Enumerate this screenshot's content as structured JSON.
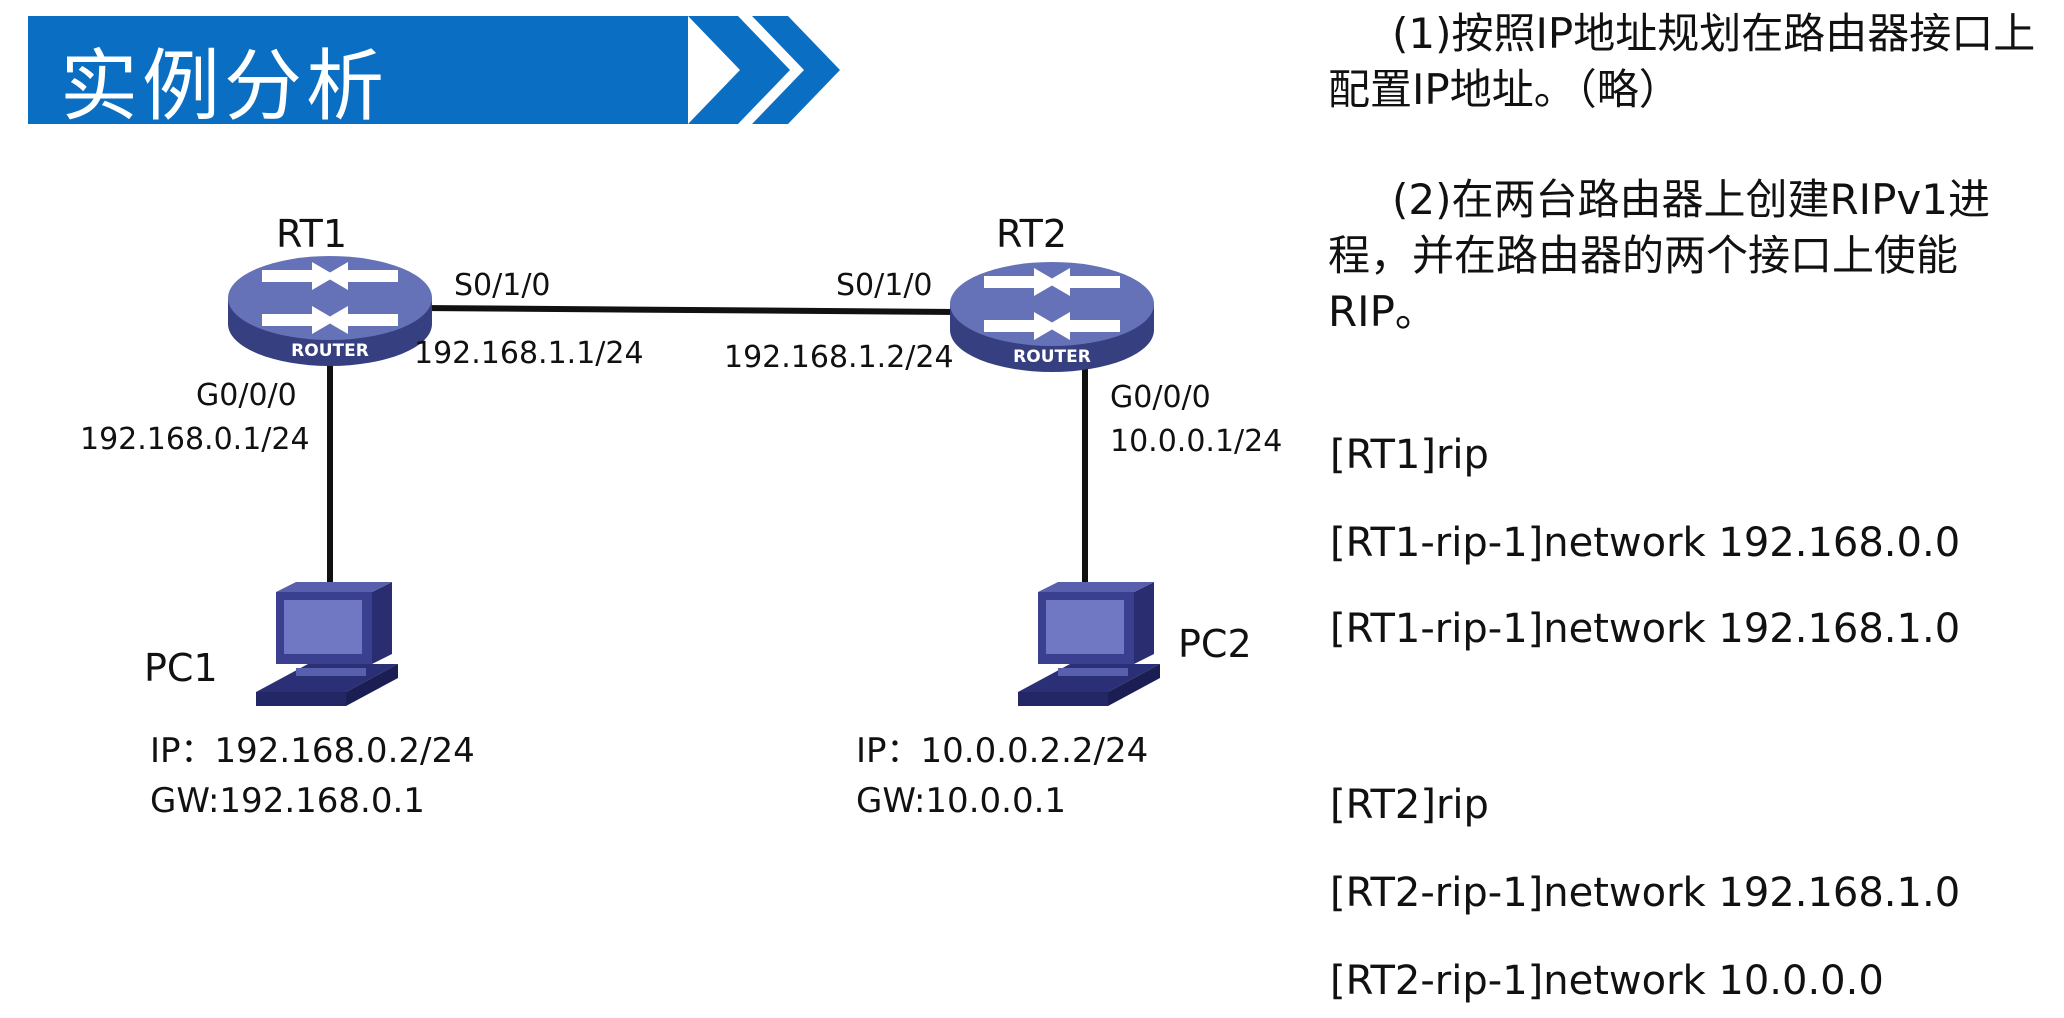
{
  "title": "实例分析",
  "colors": {
    "banner": "#0a6fc2",
    "router": "#4b58a6",
    "pc": "#3b3f8f",
    "link": "#111111"
  },
  "devices": {
    "rt1": {
      "name": "RT1",
      "badge": "ROUTER",
      "icon": "router-icon"
    },
    "rt2": {
      "name": "RT2",
      "badge": "ROUTER",
      "icon": "router-icon"
    },
    "pc1": {
      "name": "PC1",
      "icon": "pc-icon",
      "ip": "IP：192.168.0.2/24",
      "gw": "GW:192.168.0.1"
    },
    "pc2": {
      "name": "PC2",
      "icon": "pc-icon",
      "ip": "IP：10.0.0.2.2/24",
      "gw": "GW:10.0.0.1"
    }
  },
  "interfaces": {
    "rt1_s": {
      "port": "S0/1/0",
      "ip": "192.168.1.1/24"
    },
    "rt2_s": {
      "port": "S0/1/0",
      "ip": "192.168.1.2/24"
    },
    "rt1_g": {
      "port": "G0/0/0",
      "ip": "192.168.0.1/24"
    },
    "rt2_g": {
      "port": "G0/0/0",
      "ip": "10.0.0.1/24"
    }
  },
  "steps": [
    "(1)按照IP地址规划在路由器接口上配置IP地址。（略）",
    "(2)在两台路由器上创建RIPv1进程，并在路由器的两个接口上使能RIP。"
  ],
  "commands": [
    "[RT1]rip",
    "[RT1-rip-1]network 192.168.0.0",
    "[RT1-rip-1]network 192.168.1.0",
    "[RT2]rip",
    "[RT2-rip-1]network 192.168.1.0",
    "[RT2-rip-1]network 10.0.0.0"
  ]
}
